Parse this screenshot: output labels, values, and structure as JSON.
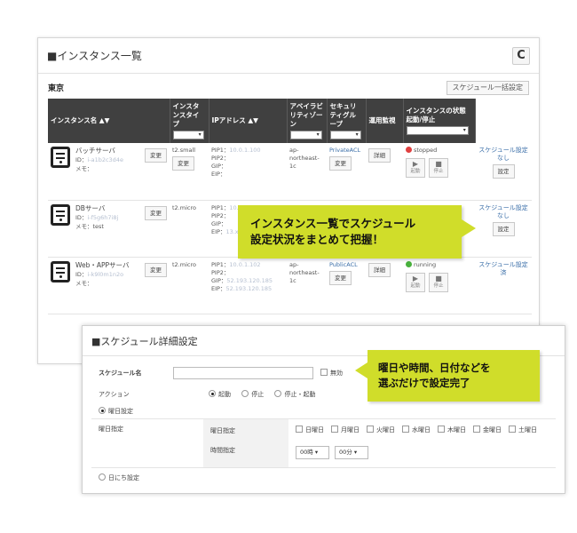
{
  "list_panel": {
    "title": "■インスタンス一覧",
    "refresh_glyph": "C",
    "region": "東京",
    "bulk_button": "スケジュール一括設定",
    "columns": {
      "name": "インスタンス名 ▲▼",
      "type": "インスタンスタイプ",
      "ip": "IPアドレス ▲▼",
      "az": "アベイラビリティゾーン",
      "sg": "セキュリティグループ",
      "monitor": "運用監視",
      "state": "インスタンスの状態 起動/停止"
    },
    "filter_arrow": "▾",
    "rows": [
      {
        "name": "バッチサーバ",
        "id_label": "ID：",
        "id_value": "i-a1b2c3d4e",
        "memo": "メモ：",
        "memo_value": "",
        "edit": "変更",
        "type": "t2.small",
        "type_btn": "変更",
        "pip1_label": "PIP1：",
        "pip1": "10.0.1.100",
        "pip2": "PIP2：",
        "gip": "GIP：",
        "gip_value": "",
        "eip": "EIP：",
        "eip_value": "",
        "az": "ap-northeast-1c",
        "sg": "PrivateACL",
        "sg_btn": "変更",
        "detail": "詳細",
        "status": "stopped",
        "status_color": "#e04040",
        "start": "起動",
        "stop": "停止",
        "schedule": "スケジュール設定なし",
        "schedule_btn": "設定",
        "schedule_color": "#3a6ea8"
      },
      {
        "name": "DBサーバ",
        "id_label": "ID：",
        "id_value": "i-f5g6h7i8j",
        "memo": "メモ：",
        "memo_value": "test",
        "edit": "変更",
        "type": "t2.micro",
        "type_btn": "",
        "pip1_label": "PIP1：",
        "pip1": "10.0.1.101",
        "pip2": "PIP2：",
        "gip": "GIP：",
        "gip_value": "",
        "eip": "EIP：",
        "eip_value": "13.x",
        "az": "",
        "sg": "",
        "sg_btn": "",
        "detail": "",
        "status": "",
        "status_color": "#e04040",
        "start": "",
        "stop": "",
        "schedule": "スケジュール設定なし",
        "schedule_btn": "設定",
        "schedule_color": "#3a6ea8"
      },
      {
        "name": "Web・APPサーバ",
        "id_label": "ID：",
        "id_value": "i-k9l0m1n2o",
        "memo": "メモ：",
        "memo_value": "",
        "edit": "変更",
        "type": "t2.micro",
        "type_btn": "",
        "pip1_label": "PIP1：",
        "pip1": "10.0.1.102",
        "pip2": "PIP2：",
        "gip": "GIP：",
        "gip_value": "52.193.120.185",
        "eip": "EIP：",
        "eip_value": "52.193.120.185",
        "az": "ap-northeast-1c",
        "sg": "PublicACL",
        "sg_btn": "変更",
        "detail": "詳細",
        "status": "running",
        "status_color": "#48b03c",
        "start": "起動",
        "stop": "停止",
        "schedule": "スケジュール設定済",
        "schedule_btn": "",
        "schedule_color": "#3a6ea8"
      }
    ]
  },
  "callouts": {
    "list_line1": "インスタンス一覧でスケジュール",
    "list_line2": "設定状況をまとめて把握！",
    "detail_line1": "曜日や時間、日付などを",
    "detail_line2": "選ぶだけで設定完了",
    "color": "#d0dd2a"
  },
  "detail_panel": {
    "title": "■スケジュール詳細設定",
    "name_label": "スケジュール名",
    "name_value": "",
    "disable_label": "無効",
    "action_label": "アクション",
    "action_options": [
      "起動",
      "停止",
      "停止・起動"
    ],
    "weekday_mode": "曜日設定",
    "weekday_left": "曜日指定",
    "weekday_mid": "曜日指定",
    "time_mid": "時間指定",
    "days": [
      "日曜日",
      "月曜日",
      "火曜日",
      "水曜日",
      "木曜日",
      "金曜日",
      "土曜日"
    ],
    "hour": "00時 ▾",
    "minute": "00分 ▾",
    "date_mode": "日にち設定"
  }
}
